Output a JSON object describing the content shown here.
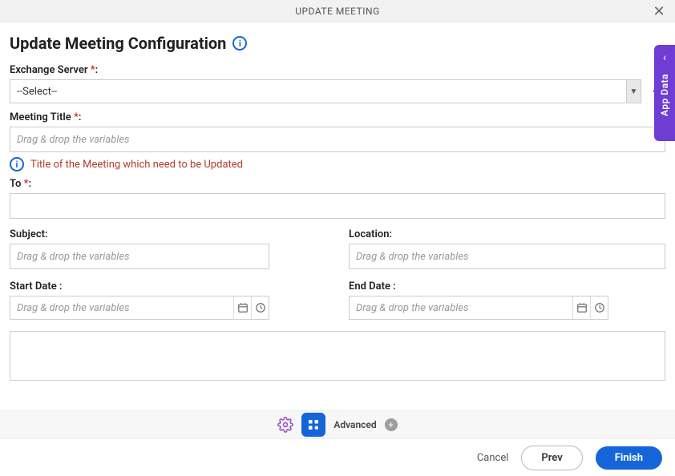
{
  "titlebar": {
    "title": "UPDATE MEETING"
  },
  "page": {
    "heading": "Update Meeting Configuration"
  },
  "fields": {
    "exchange": {
      "label": "Exchange Server",
      "selected": "--Select--"
    },
    "meetingTitle": {
      "label": "Meeting Title",
      "placeholder": "Drag & drop the variables"
    },
    "hint": "Title of the Meeting which need to be Updated",
    "to": {
      "label": "To"
    },
    "subject": {
      "label": "Subject:",
      "placeholder": "Drag & drop the variables"
    },
    "location": {
      "label": "Location:",
      "placeholder": "Drag & drop the variables"
    },
    "startDate": {
      "label": "Start Date :",
      "placeholder": "Drag & drop the variables"
    },
    "endDate": {
      "label": "End Date :",
      "placeholder": "Drag & drop the variables"
    }
  },
  "toolbar": {
    "advanced": "Advanced"
  },
  "footer": {
    "cancel": "Cancel",
    "prev": "Prev",
    "finish": "Finish"
  },
  "sideTab": {
    "label": "App Data"
  }
}
